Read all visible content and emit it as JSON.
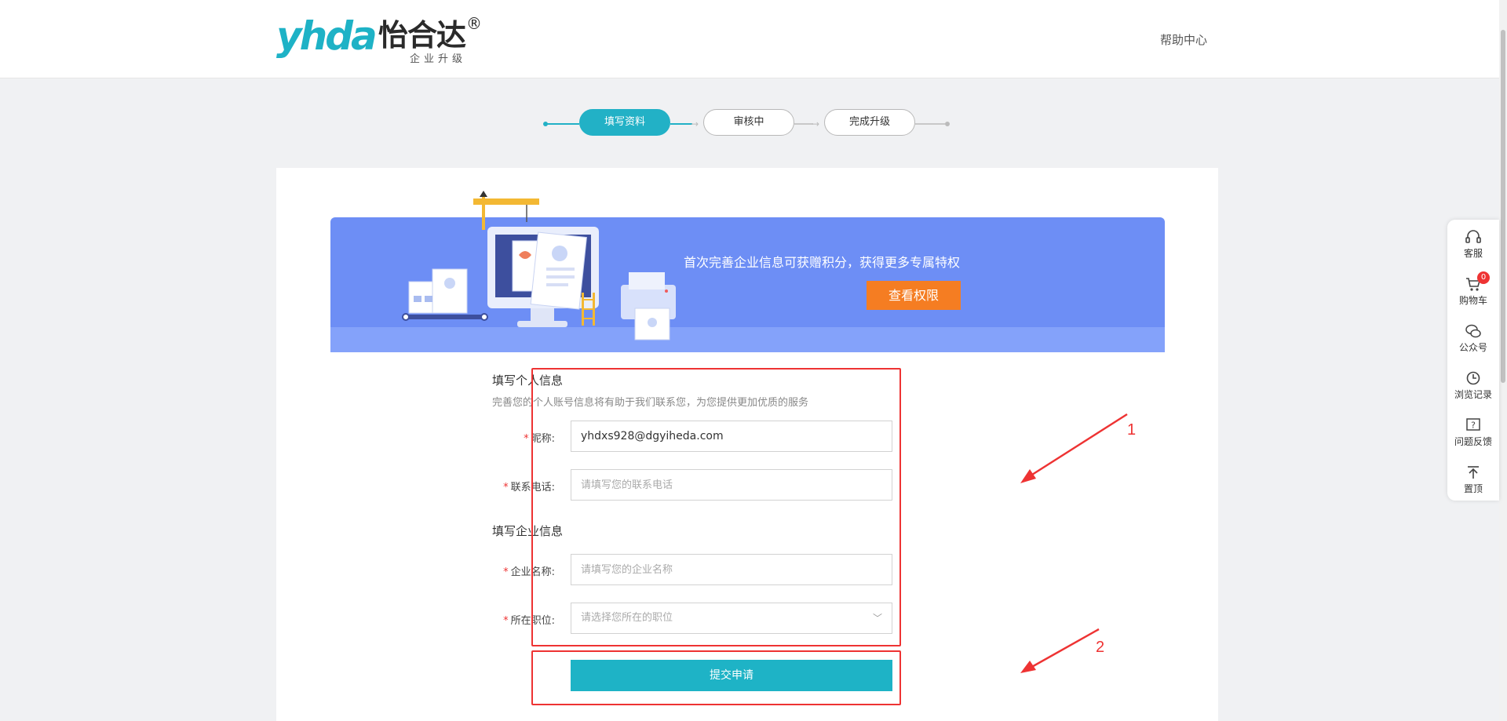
{
  "header": {
    "logo_en": "yhda",
    "logo_cn": "怡合达",
    "logo_reg": "®",
    "logo_sub": "企业升级",
    "help_link": "帮助中心"
  },
  "steps": [
    {
      "label": "填写资料",
      "state": "active"
    },
    {
      "label": "审核中",
      "state": "inactive"
    },
    {
      "label": "完成升级",
      "state": "inactive"
    }
  ],
  "banner": {
    "text": "首次完善企业信息可获赠积分，获得更多专属特权",
    "button": "查看权限"
  },
  "personal": {
    "title": "填写个人信息",
    "desc": "完善您的个人账号信息将有助于我们联系您，为您提供更加优质的服务",
    "nickname_label": "昵称:",
    "nickname_value": "yhdxs928@dgyiheda.com",
    "phone_label": "联系电话:",
    "phone_placeholder": "请填写您的联系电话"
  },
  "company": {
    "title": "填写企业信息",
    "name_label": "企业名称:",
    "name_placeholder": "请填写您的企业名称",
    "position_label": "所在职位:",
    "position_placeholder": "请选择您所在的职位"
  },
  "submit_label": "提交申请",
  "annotations": {
    "one": "1",
    "two": "2"
  },
  "sidebar": [
    {
      "label": "客服"
    },
    {
      "label": "购物车",
      "badge": "0"
    },
    {
      "label": "公众号"
    },
    {
      "label": "浏览记录"
    },
    {
      "label": "问题反馈"
    },
    {
      "label": "置顶"
    }
  ],
  "colors": {
    "brand": "#1eb3c6",
    "banner": "#6d8ef5",
    "accent": "#f57d22",
    "annotation": "#e33333"
  }
}
